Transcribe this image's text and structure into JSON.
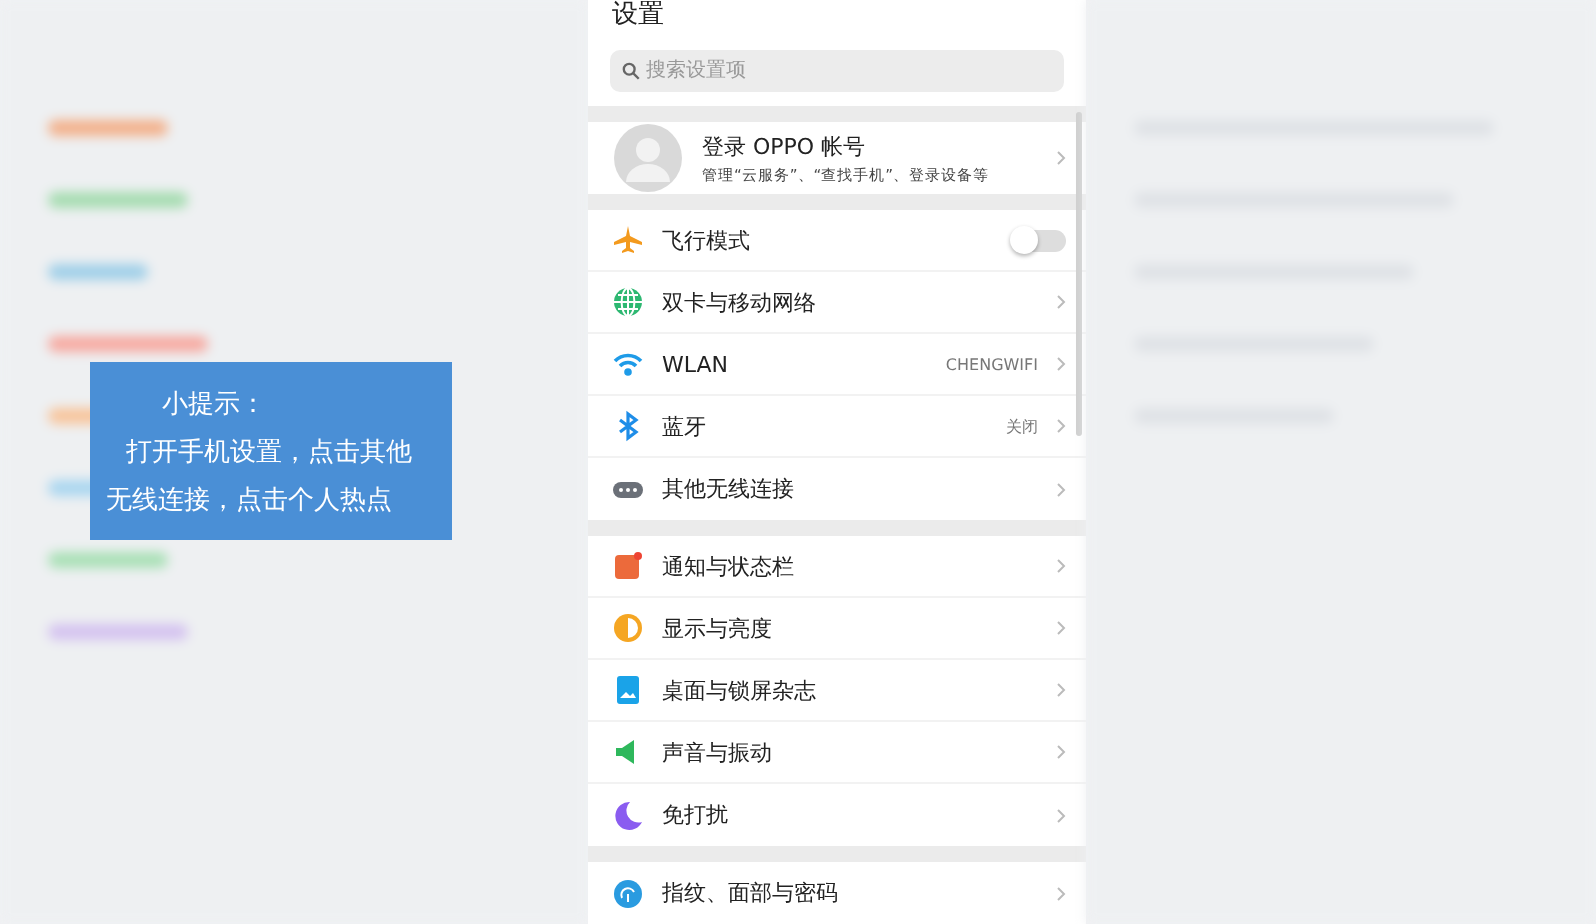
{
  "tip": {
    "title": "小提示：",
    "body": "打开手机设置，点击其他无线连接，点击个人热点"
  },
  "settings": {
    "title": "设置",
    "search": {
      "placeholder": "搜索设置项"
    },
    "account": {
      "name": "登录 OPPO 帐号",
      "subtitle": "管理“云服务”、“查找手机”、登录设备等"
    },
    "groups": [
      {
        "items": [
          {
            "kind": "toggle",
            "label": "飞行模式",
            "on": false
          },
          {
            "kind": "link",
            "label": "双卡与移动网络"
          },
          {
            "kind": "link",
            "label": "WLAN",
            "value": "CHENGWIFI"
          },
          {
            "kind": "link",
            "label": "蓝牙",
            "value": "关闭"
          },
          {
            "kind": "link",
            "label": "其他无线连接"
          }
        ]
      },
      {
        "items": [
          {
            "kind": "link",
            "label": "通知与状态栏"
          },
          {
            "kind": "link",
            "label": "显示与亮度"
          },
          {
            "kind": "link",
            "label": "桌面与锁屏杂志"
          },
          {
            "kind": "link",
            "label": "声音与振动"
          },
          {
            "kind": "link",
            "label": "免打扰"
          }
        ]
      },
      {
        "items": [
          {
            "kind": "link",
            "label": "指纹、面部与密码"
          }
        ]
      }
    ]
  }
}
